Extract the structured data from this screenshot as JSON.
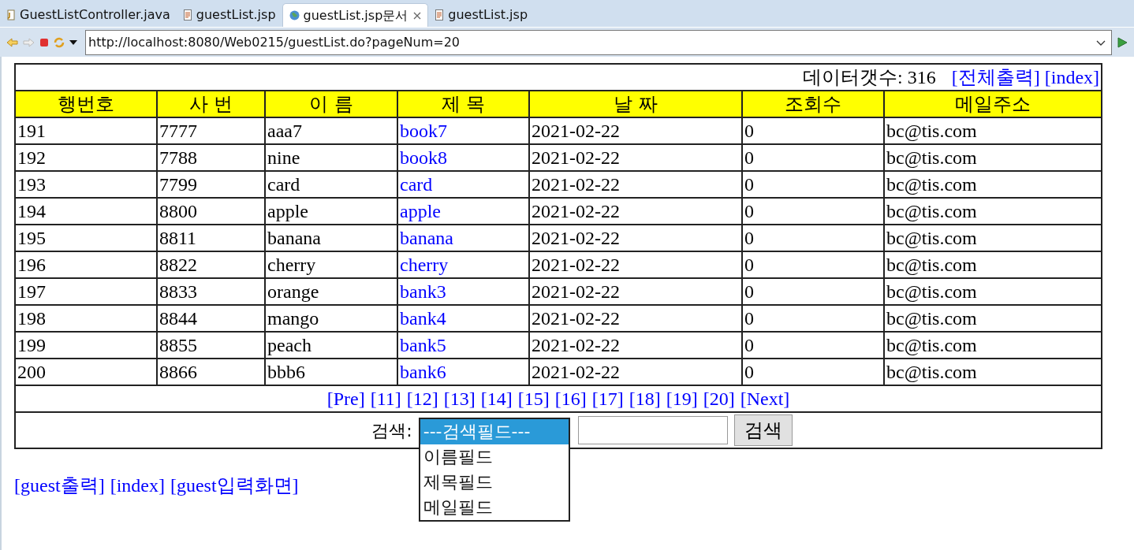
{
  "tabs": [
    {
      "label": "GuestListController.java",
      "kind": "java",
      "selected": false
    },
    {
      "label": "guestList.jsp",
      "kind": "jsp",
      "selected": false
    },
    {
      "label": "guestList.jsp문서",
      "kind": "web",
      "selected": true
    },
    {
      "label": "guestList.jsp",
      "kind": "jsp",
      "selected": false
    }
  ],
  "address": {
    "value": "http://localhost:8080/Web0215/guestList.do?pageNum=20"
  },
  "summary": {
    "label": "데이터갯수: 316",
    "links": [
      "[전체출력]",
      "[index]"
    ]
  },
  "table": {
    "columns": [
      "행번호",
      "사 번",
      "이 름",
      "제 목",
      "날 짜",
      "조회수",
      "메일주소"
    ],
    "rows": [
      [
        "191",
        "7777",
        "aaa7",
        "book7",
        "2021-02-22",
        "0",
        "bc@tis.com"
      ],
      [
        "192",
        "7788",
        "nine",
        "book8",
        "2021-02-22",
        "0",
        "bc@tis.com"
      ],
      [
        "193",
        "7799",
        "card",
        "card",
        "2021-02-22",
        "0",
        "bc@tis.com"
      ],
      [
        "194",
        "8800",
        "apple",
        "apple",
        "2021-02-22",
        "0",
        "bc@tis.com"
      ],
      [
        "195",
        "8811",
        "banana",
        "banana",
        "2021-02-22",
        "0",
        "bc@tis.com"
      ],
      [
        "196",
        "8822",
        "cherry",
        "cherry",
        "2021-02-22",
        "0",
        "bc@tis.com"
      ],
      [
        "197",
        "8833",
        "orange",
        "bank3",
        "2021-02-22",
        "0",
        "bc@tis.com"
      ],
      [
        "198",
        "8844",
        "mango",
        "bank4",
        "2021-02-22",
        "0",
        "bc@tis.com"
      ],
      [
        "199",
        "8855",
        "peach",
        "bank5",
        "2021-02-22",
        "0",
        "bc@tis.com"
      ],
      [
        "200",
        "8866",
        "bbb6",
        "bank6",
        "2021-02-22",
        "0",
        "bc@tis.com"
      ]
    ]
  },
  "pagination": [
    "[Pre]",
    "[11]",
    "[12]",
    "[13]",
    "[14]",
    "[15]",
    "[16]",
    "[17]",
    "[18]",
    "[19]",
    "[20]",
    "[Next]"
  ],
  "search": {
    "label": "검색:",
    "options": [
      {
        "label": "---검색필드---",
        "selected": true
      },
      {
        "label": "이름필드",
        "selected": false
      },
      {
        "label": "제목필드",
        "selected": false
      },
      {
        "label": "메일필드",
        "selected": false
      }
    ],
    "button": "검색"
  },
  "footer_links": [
    "[guest출력]",
    "[index]",
    "[guest입력화면]"
  ]
}
